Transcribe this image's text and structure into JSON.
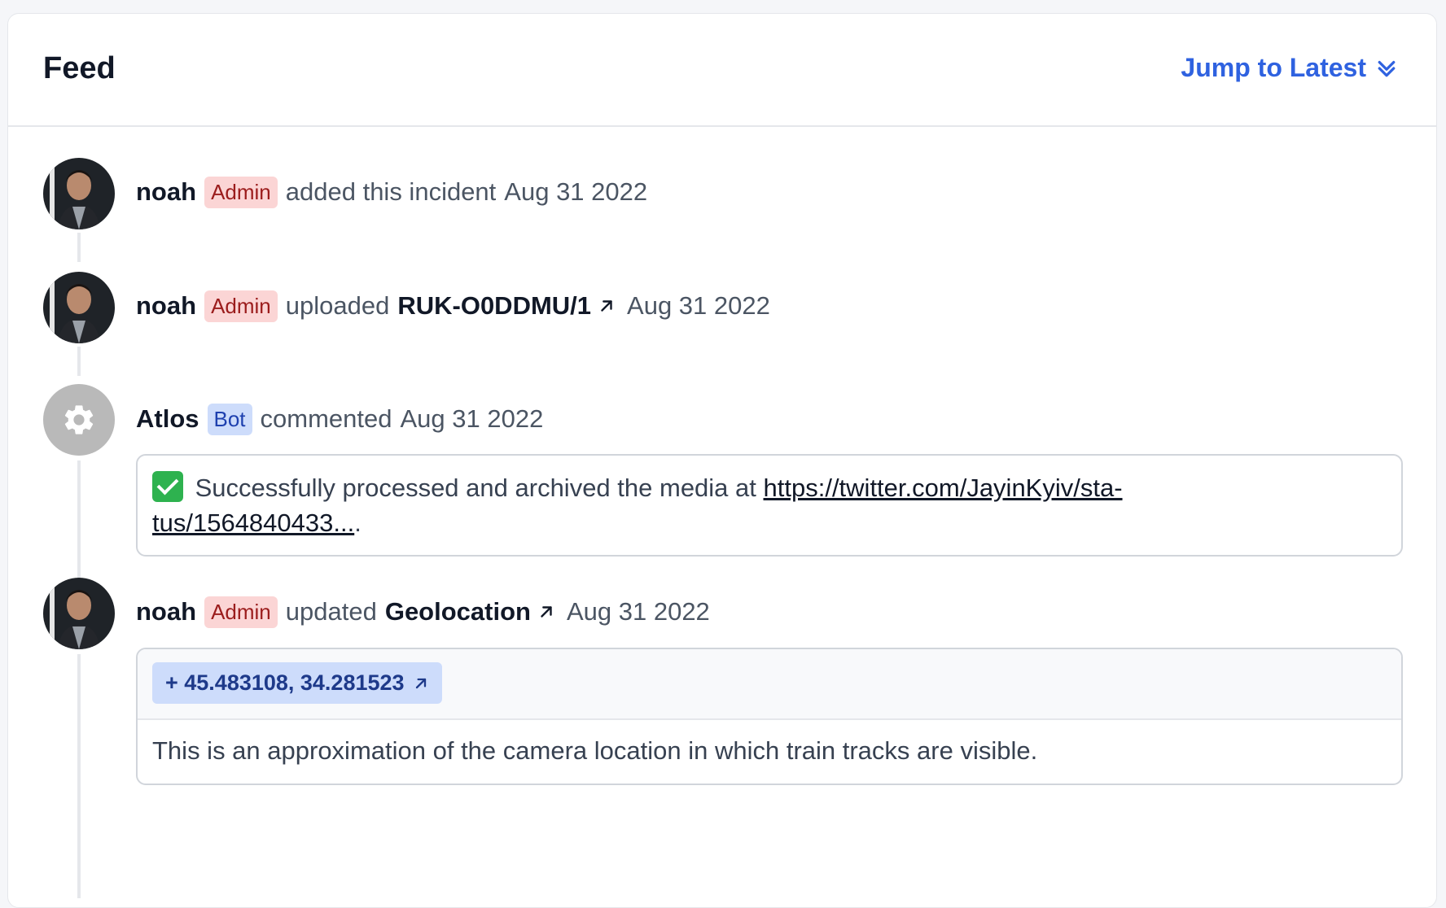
{
  "header": {
    "title": "Feed",
    "jump_label": "Jump to Latest"
  },
  "feed": [
    {
      "avatar": "profile-photo",
      "user": "noah",
      "badge": "Admin",
      "action": "added this incident",
      "date": "Aug 31 2022"
    },
    {
      "avatar": "profile-photo",
      "user": "noah",
      "badge": "Admin",
      "action": "uploaded",
      "object": "RUK-O0DDMU/1",
      "date": "Aug 31 2022"
    },
    {
      "avatar": "gear-icon",
      "user": "Atlos",
      "badge": "Bot",
      "action": "commented",
      "date": "Aug 31 2022",
      "comment_prefix": "Successfully processed and archived the media at ",
      "comment_link_line1": "https://twitter.com/JayinKyiv/sta-",
      "comment_link_line2": "tus/1564840433...",
      "comment_suffix": "."
    },
    {
      "avatar": "profile-photo",
      "user": "noah",
      "badge": "Admin",
      "action": "updated",
      "object": "Geolocation",
      "date": "Aug 31 2022",
      "geo_chip": "+ 45.483108, 34.281523",
      "description": "This is an approximation of the camera location in which train tracks are visible."
    }
  ],
  "colors": {
    "accent": "#2f62e0",
    "admin_badge_bg": "#fbd5d5",
    "admin_badge_text": "#9b1c1c",
    "bot_badge_bg": "#cddcfb",
    "bot_badge_text": "#1e40af"
  }
}
